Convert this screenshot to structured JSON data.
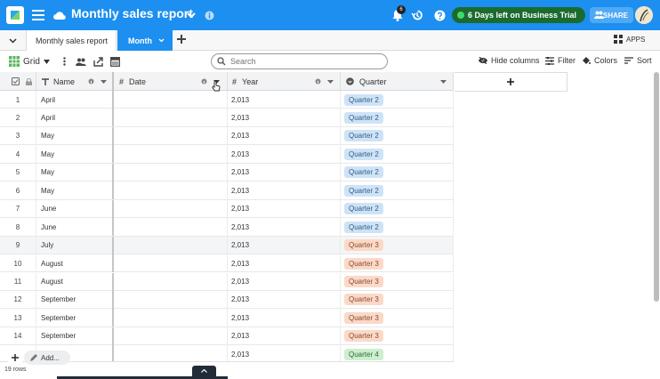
{
  "header": {
    "title": "Monthly sales report",
    "notification_count": "6",
    "trial_label": "6 Days left on Business Trial",
    "share_label": "SHARE"
  },
  "tabs": [
    {
      "label": "Monthly sales report",
      "active": false
    },
    {
      "label": "Month",
      "active": true
    }
  ],
  "apps_label": "APPS",
  "toolbar": {
    "view_label": "Grid",
    "search_placeholder": "Search",
    "hide_columns": "Hide columns",
    "filter": "Filter",
    "colors": "Colors",
    "sort": "Sort"
  },
  "columns": {
    "name": "Name",
    "date": "Date",
    "year": "Year",
    "quarter": "Quarter"
  },
  "rows": [
    {
      "num": "1",
      "name": "April",
      "year": "2,013",
      "quarter": "Quarter 2"
    },
    {
      "num": "2",
      "name": "April",
      "year": "2,013",
      "quarter": "Quarter 2"
    },
    {
      "num": "3",
      "name": "May",
      "year": "2,013",
      "quarter": "Quarter 2"
    },
    {
      "num": "4",
      "name": "May",
      "year": "2,013",
      "quarter": "Quarter 2"
    },
    {
      "num": "5",
      "name": "May",
      "year": "2,013",
      "quarter": "Quarter 2"
    },
    {
      "num": "6",
      "name": "May",
      "year": "2,013",
      "quarter": "Quarter 2"
    },
    {
      "num": "7",
      "name": "June",
      "year": "2,013",
      "quarter": "Quarter 2"
    },
    {
      "num": "8",
      "name": "June",
      "year": "2,013",
      "quarter": "Quarter 2"
    },
    {
      "num": "9",
      "name": "July",
      "year": "2,013",
      "quarter": "Quarter 3"
    },
    {
      "num": "10",
      "name": "August",
      "year": "2,013",
      "quarter": "Quarter 3"
    },
    {
      "num": "11",
      "name": "August",
      "year": "2,013",
      "quarter": "Quarter 3"
    },
    {
      "num": "12",
      "name": "September",
      "year": "2,013",
      "quarter": "Quarter 3"
    },
    {
      "num": "13",
      "name": "September",
      "year": "2,013",
      "quarter": "Quarter 3"
    },
    {
      "num": "14",
      "name": "September",
      "year": "2,013",
      "quarter": "Quarter 3"
    },
    {
      "num": "",
      "name": "",
      "year": "2,013",
      "quarter": "Quarter 4"
    }
  ],
  "quarter_colors": {
    "Quarter 2": {
      "bg": "#cfe3f7",
      "fg": "#2f5d86"
    },
    "Quarter 3": {
      "bg": "#fbd9c8",
      "fg": "#8a4a2c"
    },
    "Quarter 4": {
      "bg": "#cdeecf",
      "fg": "#2f6b35"
    }
  },
  "footer": {
    "add_label": "Add...",
    "row_count": "19 rows"
  },
  "colors": {
    "brand": "#1c8ff0",
    "trial_bg": "#1b6b2f"
  }
}
